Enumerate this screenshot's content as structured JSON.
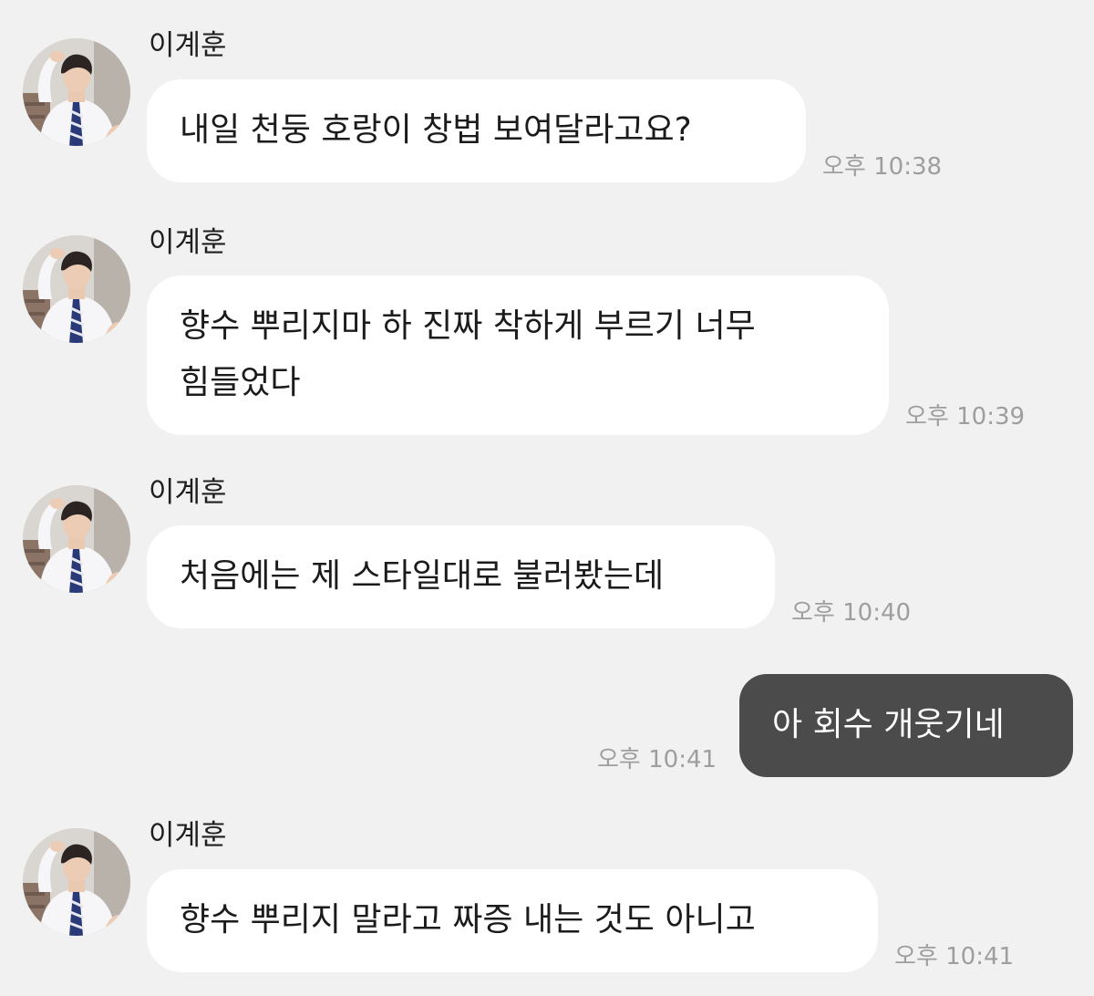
{
  "messages": [
    {
      "direction": "incoming",
      "sender": "이계훈",
      "avatar_icon": "profile-photo-icon",
      "lines": [
        "내일 천둥 호랑이 창법 보여달라고요?"
      ],
      "time": "오후 10:38"
    },
    {
      "direction": "incoming",
      "sender": "이계훈",
      "avatar_icon": "profile-photo-icon",
      "lines": [
        "향수 뿌리지마 하 진짜 착하게 부르기 너무",
        "힘들었다"
      ],
      "time": "오후 10:39"
    },
    {
      "direction": "incoming",
      "sender": "이계훈",
      "avatar_icon": "profile-photo-icon",
      "lines": [
        "처음에는 제 스타일대로 불러봤는데"
      ],
      "time": "오후 10:40"
    },
    {
      "direction": "outgoing",
      "lines": [
        "아 회수 개웃기네"
      ],
      "time": "오후 10:41"
    },
    {
      "direction": "incoming",
      "sender": "이계훈",
      "avatar_icon": "profile-photo-icon",
      "lines": [
        "향수 뿌리지 말라고 짜증 내는 것도 아니고"
      ],
      "time": "오후 10:41"
    }
  ],
  "colors": {
    "background": "#f1f1f1",
    "incoming_bubble": "#ffffff",
    "outgoing_bubble": "#4b4b4b",
    "timestamp": "#9e9e9e"
  }
}
